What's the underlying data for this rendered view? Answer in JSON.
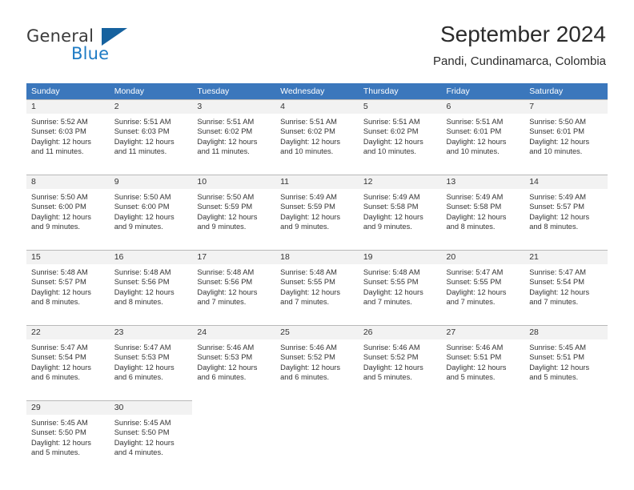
{
  "brand": {
    "name_part1": "General",
    "name_part2": "Blue",
    "triangle_icon": "blue-triangle-logo-mark",
    "accent_color": "#1e7bc4",
    "dark_color": "#3b3b3b"
  },
  "header": {
    "title": "September 2024",
    "subtitle": "Pandi, Cundinamarca, Colombia"
  },
  "calendar": {
    "header_bg": "#3b77bc",
    "date_strip_bg": "#f2f2f2",
    "day_names": [
      "Sunday",
      "Monday",
      "Tuesday",
      "Wednesday",
      "Thursday",
      "Friday",
      "Saturday"
    ],
    "weeks": [
      [
        {
          "date": "1",
          "sunrise": "Sunrise: 5:52 AM",
          "sunset": "Sunset: 6:03 PM",
          "daylight_line1": "Daylight: 12 hours",
          "daylight_line2": "and 11 minutes."
        },
        {
          "date": "2",
          "sunrise": "Sunrise: 5:51 AM",
          "sunset": "Sunset: 6:03 PM",
          "daylight_line1": "Daylight: 12 hours",
          "daylight_line2": "and 11 minutes."
        },
        {
          "date": "3",
          "sunrise": "Sunrise: 5:51 AM",
          "sunset": "Sunset: 6:02 PM",
          "daylight_line1": "Daylight: 12 hours",
          "daylight_line2": "and 11 minutes."
        },
        {
          "date": "4",
          "sunrise": "Sunrise: 5:51 AM",
          "sunset": "Sunset: 6:02 PM",
          "daylight_line1": "Daylight: 12 hours",
          "daylight_line2": "and 10 minutes."
        },
        {
          "date": "5",
          "sunrise": "Sunrise: 5:51 AM",
          "sunset": "Sunset: 6:02 PM",
          "daylight_line1": "Daylight: 12 hours",
          "daylight_line2": "and 10 minutes."
        },
        {
          "date": "6",
          "sunrise": "Sunrise: 5:51 AM",
          "sunset": "Sunset: 6:01 PM",
          "daylight_line1": "Daylight: 12 hours",
          "daylight_line2": "and 10 minutes."
        },
        {
          "date": "7",
          "sunrise": "Sunrise: 5:50 AM",
          "sunset": "Sunset: 6:01 PM",
          "daylight_line1": "Daylight: 12 hours",
          "daylight_line2": "and 10 minutes."
        }
      ],
      [
        {
          "date": "8",
          "sunrise": "Sunrise: 5:50 AM",
          "sunset": "Sunset: 6:00 PM",
          "daylight_line1": "Daylight: 12 hours",
          "daylight_line2": "and 9 minutes."
        },
        {
          "date": "9",
          "sunrise": "Sunrise: 5:50 AM",
          "sunset": "Sunset: 6:00 PM",
          "daylight_line1": "Daylight: 12 hours",
          "daylight_line2": "and 9 minutes."
        },
        {
          "date": "10",
          "sunrise": "Sunrise: 5:50 AM",
          "sunset": "Sunset: 5:59 PM",
          "daylight_line1": "Daylight: 12 hours",
          "daylight_line2": "and 9 minutes."
        },
        {
          "date": "11",
          "sunrise": "Sunrise: 5:49 AM",
          "sunset": "Sunset: 5:59 PM",
          "daylight_line1": "Daylight: 12 hours",
          "daylight_line2": "and 9 minutes."
        },
        {
          "date": "12",
          "sunrise": "Sunrise: 5:49 AM",
          "sunset": "Sunset: 5:58 PM",
          "daylight_line1": "Daylight: 12 hours",
          "daylight_line2": "and 9 minutes."
        },
        {
          "date": "13",
          "sunrise": "Sunrise: 5:49 AM",
          "sunset": "Sunset: 5:58 PM",
          "daylight_line1": "Daylight: 12 hours",
          "daylight_line2": "and 8 minutes."
        },
        {
          "date": "14",
          "sunrise": "Sunrise: 5:49 AM",
          "sunset": "Sunset: 5:57 PM",
          "daylight_line1": "Daylight: 12 hours",
          "daylight_line2": "and 8 minutes."
        }
      ],
      [
        {
          "date": "15",
          "sunrise": "Sunrise: 5:48 AM",
          "sunset": "Sunset: 5:57 PM",
          "daylight_line1": "Daylight: 12 hours",
          "daylight_line2": "and 8 minutes."
        },
        {
          "date": "16",
          "sunrise": "Sunrise: 5:48 AM",
          "sunset": "Sunset: 5:56 PM",
          "daylight_line1": "Daylight: 12 hours",
          "daylight_line2": "and 8 minutes."
        },
        {
          "date": "17",
          "sunrise": "Sunrise: 5:48 AM",
          "sunset": "Sunset: 5:56 PM",
          "daylight_line1": "Daylight: 12 hours",
          "daylight_line2": "and 7 minutes."
        },
        {
          "date": "18",
          "sunrise": "Sunrise: 5:48 AM",
          "sunset": "Sunset: 5:55 PM",
          "daylight_line1": "Daylight: 12 hours",
          "daylight_line2": "and 7 minutes."
        },
        {
          "date": "19",
          "sunrise": "Sunrise: 5:48 AM",
          "sunset": "Sunset: 5:55 PM",
          "daylight_line1": "Daylight: 12 hours",
          "daylight_line2": "and 7 minutes."
        },
        {
          "date": "20",
          "sunrise": "Sunrise: 5:47 AM",
          "sunset": "Sunset: 5:55 PM",
          "daylight_line1": "Daylight: 12 hours",
          "daylight_line2": "and 7 minutes."
        },
        {
          "date": "21",
          "sunrise": "Sunrise: 5:47 AM",
          "sunset": "Sunset: 5:54 PM",
          "daylight_line1": "Daylight: 12 hours",
          "daylight_line2": "and 7 minutes."
        }
      ],
      [
        {
          "date": "22",
          "sunrise": "Sunrise: 5:47 AM",
          "sunset": "Sunset: 5:54 PM",
          "daylight_line1": "Daylight: 12 hours",
          "daylight_line2": "and 6 minutes."
        },
        {
          "date": "23",
          "sunrise": "Sunrise: 5:47 AM",
          "sunset": "Sunset: 5:53 PM",
          "daylight_line1": "Daylight: 12 hours",
          "daylight_line2": "and 6 minutes."
        },
        {
          "date": "24",
          "sunrise": "Sunrise: 5:46 AM",
          "sunset": "Sunset: 5:53 PM",
          "daylight_line1": "Daylight: 12 hours",
          "daylight_line2": "and 6 minutes."
        },
        {
          "date": "25",
          "sunrise": "Sunrise: 5:46 AM",
          "sunset": "Sunset: 5:52 PM",
          "daylight_line1": "Daylight: 12 hours",
          "daylight_line2": "and 6 minutes."
        },
        {
          "date": "26",
          "sunrise": "Sunrise: 5:46 AM",
          "sunset": "Sunset: 5:52 PM",
          "daylight_line1": "Daylight: 12 hours",
          "daylight_line2": "and 5 minutes."
        },
        {
          "date": "27",
          "sunrise": "Sunrise: 5:46 AM",
          "sunset": "Sunset: 5:51 PM",
          "daylight_line1": "Daylight: 12 hours",
          "daylight_line2": "and 5 minutes."
        },
        {
          "date": "28",
          "sunrise": "Sunrise: 5:45 AM",
          "sunset": "Sunset: 5:51 PM",
          "daylight_line1": "Daylight: 12 hours",
          "daylight_line2": "and 5 minutes."
        }
      ],
      [
        {
          "date": "29",
          "sunrise": "Sunrise: 5:45 AM",
          "sunset": "Sunset: 5:50 PM",
          "daylight_line1": "Daylight: 12 hours",
          "daylight_line2": "and 5 minutes."
        },
        {
          "date": "30",
          "sunrise": "Sunrise: 5:45 AM",
          "sunset": "Sunset: 5:50 PM",
          "daylight_line1": "Daylight: 12 hours",
          "daylight_line2": "and 4 minutes."
        },
        {
          "date": "",
          "sunrise": "",
          "sunset": "",
          "daylight_line1": "",
          "daylight_line2": ""
        },
        {
          "date": "",
          "sunrise": "",
          "sunset": "",
          "daylight_line1": "",
          "daylight_line2": ""
        },
        {
          "date": "",
          "sunrise": "",
          "sunset": "",
          "daylight_line1": "",
          "daylight_line2": ""
        },
        {
          "date": "",
          "sunrise": "",
          "sunset": "",
          "daylight_line1": "",
          "daylight_line2": ""
        },
        {
          "date": "",
          "sunrise": "",
          "sunset": "",
          "daylight_line1": "",
          "daylight_line2": ""
        }
      ]
    ]
  }
}
